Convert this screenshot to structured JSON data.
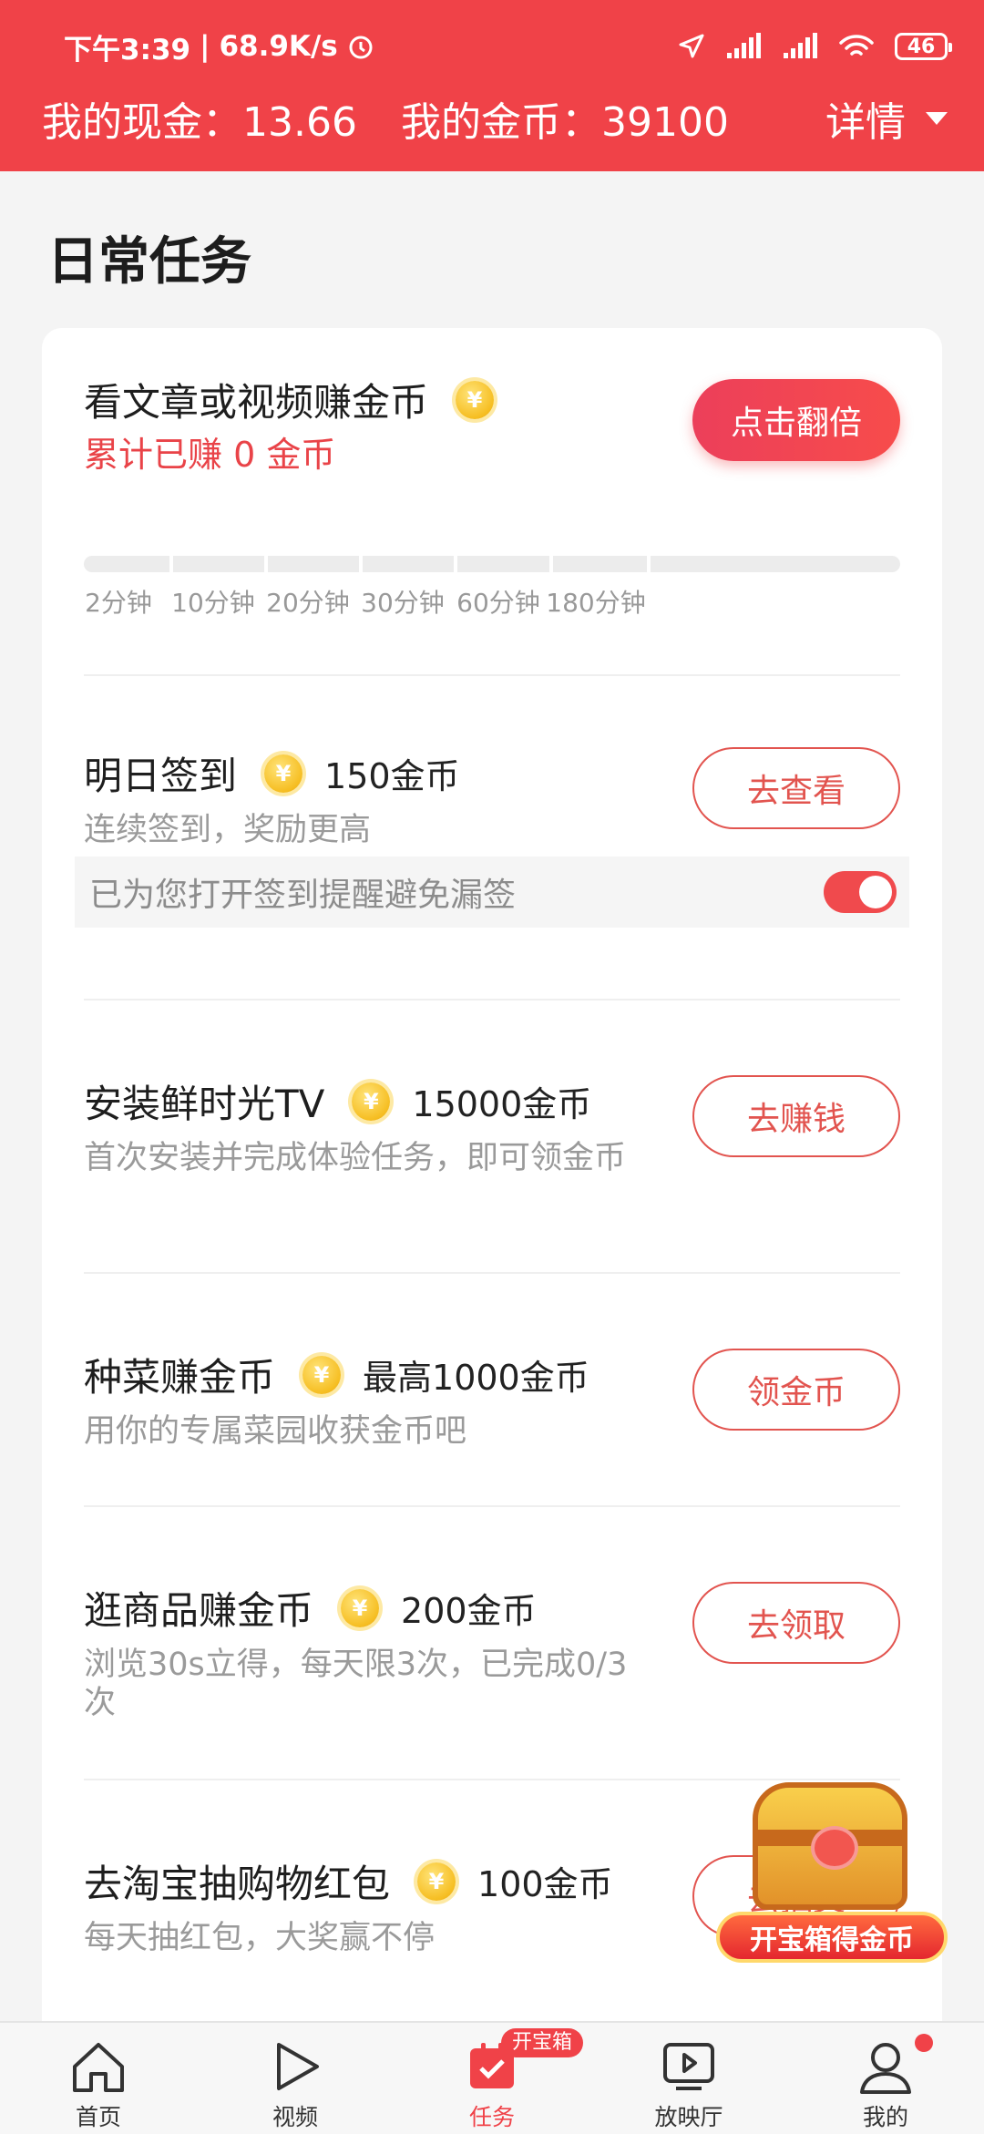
{
  "status_bar": {
    "time": "下午3:39",
    "speed": "68.9K/s",
    "battery": "46"
  },
  "header": {
    "cash_label": "我的现金：",
    "cash_value": "13.66",
    "coin_label": "我的金币：",
    "coin_value": "39100",
    "detail_label": "详情"
  },
  "section_title": "日常任务",
  "watch_task": {
    "title": "看文章或视频赚金币",
    "earned": "累计已赚 0 金币",
    "button": "点击翻倍",
    "milestones": [
      "2分钟",
      "10分钟",
      "20分钟",
      "30分钟",
      "60分钟",
      "180分钟"
    ],
    "progress": 0
  },
  "tasks": [
    {
      "title": "明日签到",
      "reward": "150金币",
      "desc": "连续签到，奖励更高",
      "button": "去查看"
    },
    {
      "title": "安装鲜时光TV",
      "reward": "15000金币",
      "desc": "首次安装并完成体验任务，即可领金币",
      "button": "去赚钱"
    },
    {
      "title": "种菜赚金币",
      "reward": "最高1000金币",
      "desc": "用你的专属菜园收获金币吧",
      "button": "领金币"
    },
    {
      "title": "逛商品赚金币",
      "reward": "200金币",
      "desc": "浏览30s立得，每天限3次，已完成0/3次",
      "button": "去领取"
    },
    {
      "title": "去淘宝抽购物红包",
      "reward": "100金币",
      "desc": "每天抽红包，大奖赢不停",
      "button": "去抽奖"
    }
  ],
  "reminder": {
    "text": "已为您打开签到提醒避免漏签",
    "enabled": true
  },
  "coin_symbol": "¥",
  "chest": {
    "label": "开宝箱得金币"
  },
  "bottom_nav": [
    {
      "label": "首页",
      "icon": "home-icon"
    },
    {
      "label": "视频",
      "icon": "play-icon"
    },
    {
      "label": "任务",
      "icon": "task-icon",
      "badge": "开宝箱"
    },
    {
      "label": "放映厅",
      "icon": "screen-icon"
    },
    {
      "label": "我的",
      "icon": "person-icon"
    }
  ],
  "colors": {
    "accent": "#f04248",
    "button_border": "#e2544f"
  }
}
